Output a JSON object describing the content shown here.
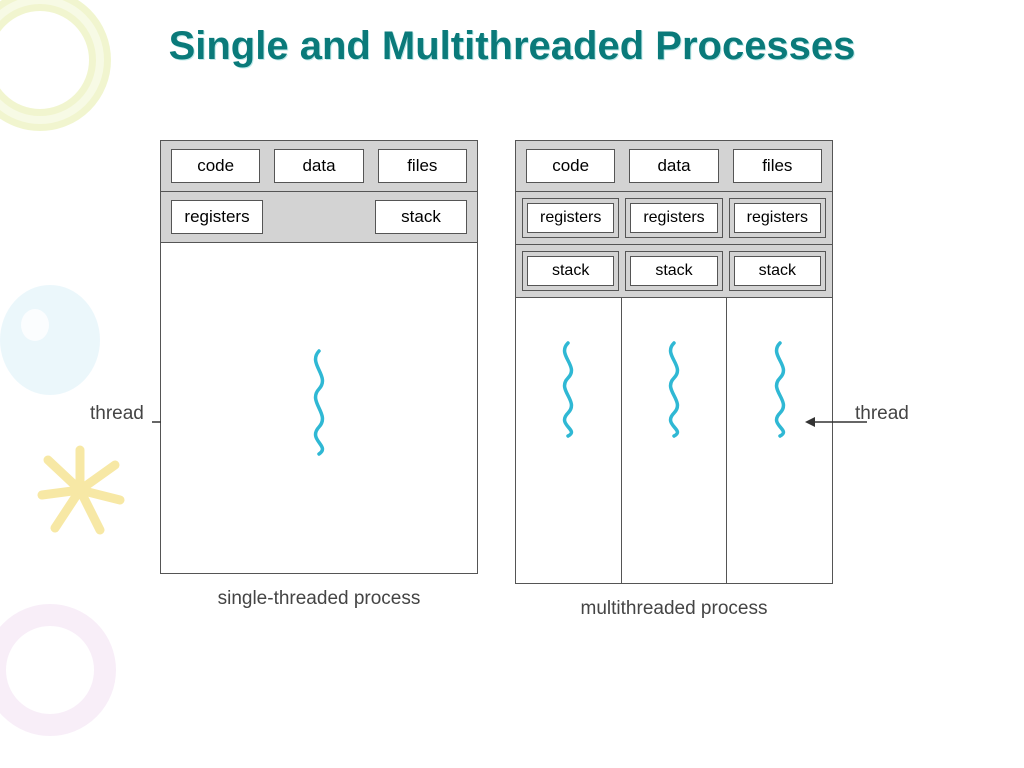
{
  "title": "Single and Multithreaded Processes",
  "shared": {
    "code": "code",
    "data": "data",
    "files": "files"
  },
  "single": {
    "registers": "registers",
    "stack": "stack",
    "thread_label": "thread",
    "caption": "single-threaded process"
  },
  "multi": {
    "registers": "registers",
    "stack": "stack",
    "thread_label": "thread",
    "caption": "multithreaded process",
    "thread_count": 3
  },
  "colors": {
    "title": "#0a7a7a",
    "thread_wave": "#2fb8d4",
    "box_border": "#555",
    "shared_bg": "#d3d3d3"
  }
}
